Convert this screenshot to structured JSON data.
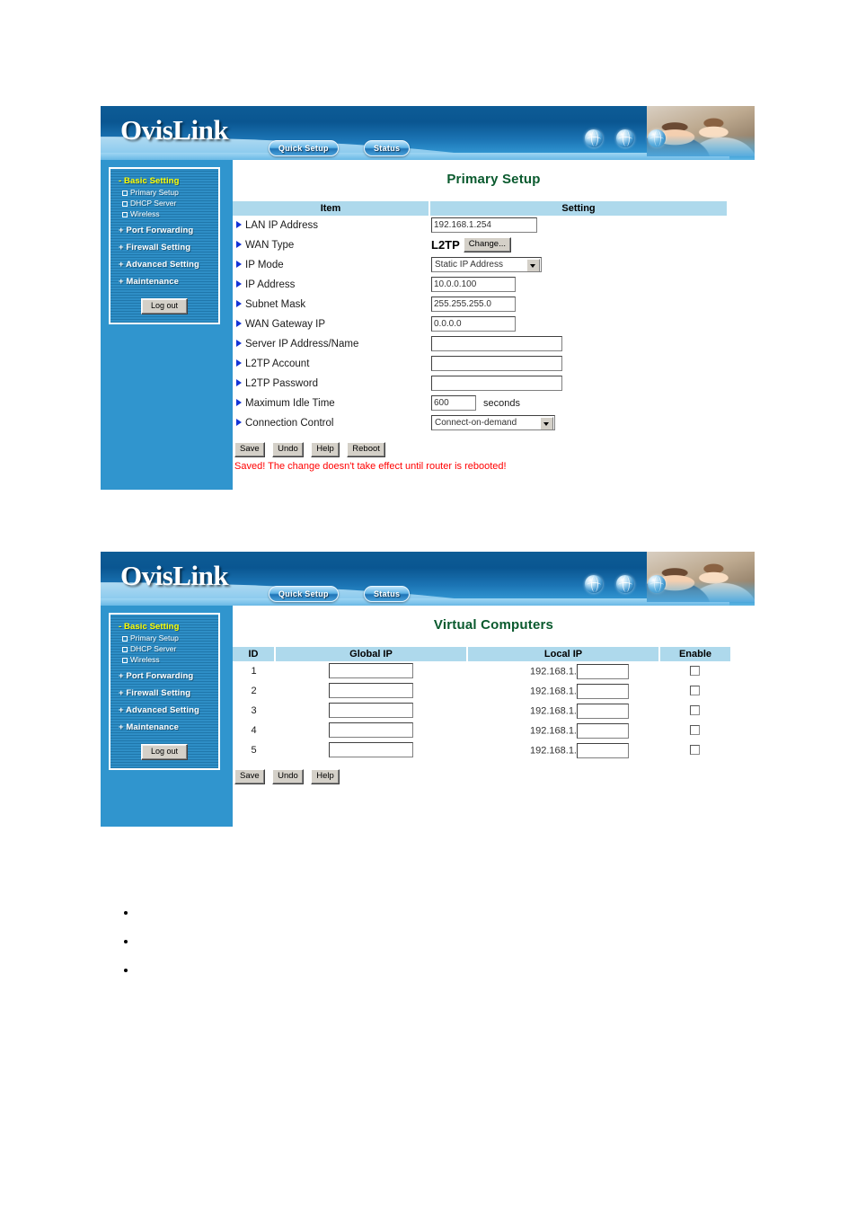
{
  "brand": {
    "logo_text": "OvisLink",
    "nav": [
      {
        "label": "Quick Setup",
        "name": "quick-setup"
      },
      {
        "label": "Status",
        "name": "status"
      }
    ]
  },
  "sidebar": {
    "groups": [
      {
        "label": "- Basic Setting",
        "expanded": true,
        "highlight_color": "#ffff00",
        "children": [
          {
            "label": "Primary Setup"
          },
          {
            "label": "DHCP Server"
          },
          {
            "label": "Wireless"
          }
        ]
      },
      {
        "label": "+ Port Forwarding",
        "expanded": false,
        "children": []
      },
      {
        "label": "+ Firewall Setting",
        "expanded": false,
        "children": []
      },
      {
        "label": "+ Advanced Setting",
        "expanded": false,
        "children": []
      },
      {
        "label": "+ Maintenance",
        "expanded": false,
        "children": []
      }
    ],
    "logout_label": "Log out"
  },
  "primary_setup": {
    "title": "Primary Setup",
    "headers": {
      "item": "Item",
      "setting": "Setting"
    },
    "rows": [
      {
        "label": "LAN IP Address",
        "type": "text",
        "value": "192.168.1.254"
      },
      {
        "label": "WAN Type",
        "type": "wan",
        "value": "L2TP",
        "button": "Change..."
      },
      {
        "label": "IP Mode",
        "type": "select",
        "value": "Static IP Address"
      },
      {
        "label": "IP Address",
        "type": "text",
        "value": "10.0.0.100"
      },
      {
        "label": "Subnet Mask",
        "type": "text",
        "value": "255.255.255.0"
      },
      {
        "label": "WAN Gateway IP",
        "type": "text",
        "value": "0.0.0.0"
      },
      {
        "label": "Server IP Address/Name",
        "type": "text-wide",
        "value": ""
      },
      {
        "label": "L2TP Account",
        "type": "text-wide",
        "value": ""
      },
      {
        "label": "L2TP Password",
        "type": "text-wide",
        "value": ""
      },
      {
        "label": "Maximum Idle Time",
        "type": "text-units",
        "value": "600",
        "units": "seconds"
      },
      {
        "label": "Connection Control",
        "type": "select",
        "value": "Connect-on-demand"
      }
    ],
    "buttons": [
      "Save",
      "Undo",
      "Help",
      "Reboot"
    ],
    "status_message": "Saved! The change doesn't take effect until router is rebooted!",
    "status_color": "#ff0000"
  },
  "virtual_computers": {
    "title": "Virtual Computers",
    "headers": {
      "id": "ID",
      "global_ip": "Global IP",
      "local_ip": "Local IP",
      "enable": "Enable"
    },
    "local_ip_prefix": "192.168.1.",
    "rows": [
      {
        "id": "1",
        "global_ip": "",
        "local_ip": "",
        "enable": false
      },
      {
        "id": "2",
        "global_ip": "",
        "local_ip": "",
        "enable": false
      },
      {
        "id": "3",
        "global_ip": "",
        "local_ip": "",
        "enable": false
      },
      {
        "id": "4",
        "global_ip": "",
        "local_ip": "",
        "enable": false
      },
      {
        "id": "5",
        "global_ip": "",
        "local_ip": "",
        "enable": false
      }
    ],
    "buttons": [
      "Save",
      "Undo",
      "Help"
    ]
  },
  "document_bullets": [
    "",
    "",
    ""
  ],
  "colors": {
    "sidebar_blue": "#3095ce",
    "table_header_blue": "#aed9ec",
    "title_green": "#0a5a2e",
    "banner_dark_blue": "#0a5691",
    "menu_highlight": "#ffff00"
  }
}
